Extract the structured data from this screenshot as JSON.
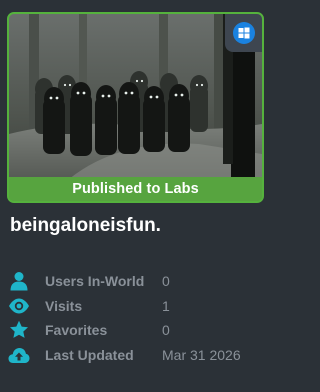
{
  "world": {
    "name": "beingaloneisfun.",
    "status_banner": "Published to Labs",
    "platform_icon": "windows-icon"
  },
  "colors": {
    "background": "#2b3137",
    "banner_green": "#57a43f",
    "icon_teal": "#1fb5c9",
    "muted_text": "#8a9199",
    "platform_blue": "#1a82e0"
  },
  "stats": [
    {
      "label": "Users In-World",
      "value": "0",
      "icon": "users-icon"
    },
    {
      "label": "Visits",
      "value": "1",
      "icon": "eye-icon"
    },
    {
      "label": "Favorites",
      "value": "0",
      "icon": "star-icon"
    },
    {
      "label": "Last Updated",
      "value": "Mar 31 2026",
      "icon": "cloud-upload-icon"
    }
  ]
}
